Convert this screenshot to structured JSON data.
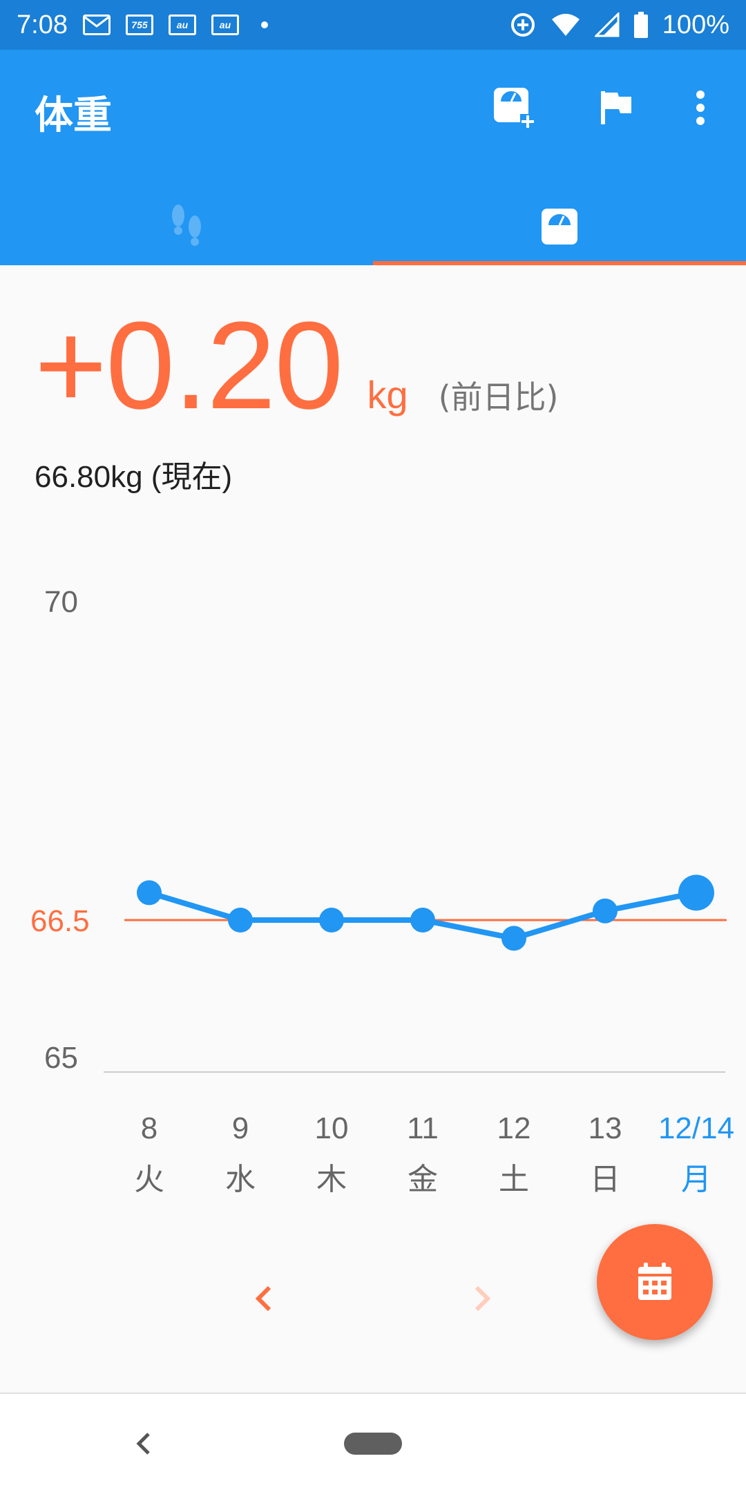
{
  "status_bar": {
    "time": "7:08",
    "battery": "100%",
    "notif_icons": [
      "mail-icon",
      "755-icon",
      "au-icon",
      "au-icon"
    ],
    "notif_755": "755",
    "notif_au": "au"
  },
  "app_bar": {
    "title": "体重",
    "actions": [
      "add-weight-icon",
      "flag-icon",
      "more-vert-icon"
    ],
    "tabs": [
      "footsteps-icon",
      "scale-icon"
    ],
    "selected_tab": 1
  },
  "summary": {
    "delta_value": "+0.20",
    "delta_unit": "kg",
    "delta_caption": "(前日比)",
    "current": "66.80kg (現在)"
  },
  "chart_data": {
    "type": "line",
    "x": [
      "8",
      "9",
      "10",
      "11",
      "12",
      "13",
      "12/14"
    ],
    "weekdays": [
      "火",
      "水",
      "木",
      "金",
      "土",
      "日",
      "月"
    ],
    "values": [
      66.8,
      66.5,
      66.5,
      66.5,
      66.3,
      66.6,
      66.8
    ],
    "ytick_labels": [
      "70",
      "66.5",
      "65"
    ],
    "ylim": [
      65,
      70
    ],
    "target_value": 66.5,
    "highlight_index": 6
  },
  "colors": {
    "primary": "#2196f3",
    "status_bar": "#1a7fd6",
    "accent": "#ff6e40",
    "axis_text": "#666666"
  },
  "pager": {
    "prev_icon": "chevron-left-icon",
    "next_icon": "chevron-right-icon"
  },
  "fab": {
    "icon": "calendar-icon"
  }
}
